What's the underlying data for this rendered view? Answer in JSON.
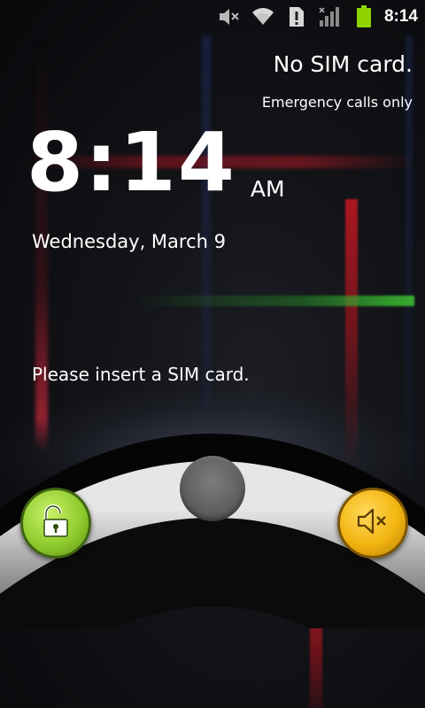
{
  "status_bar": {
    "icons": [
      "mute-icon",
      "wifi-icon",
      "alert-icon",
      "signal-icon",
      "battery-icon"
    ],
    "time": "8:14"
  },
  "lockscreen": {
    "carrier": "No SIM card.",
    "emergency": "Emergency calls only",
    "time": "8:14",
    "ampm": "AM",
    "date": "Wednesday, March 9",
    "message": "Please insert a SIM card."
  },
  "slider": {
    "left_icon": "unlock-icon",
    "right_icon": "sound-off-icon",
    "colors": {
      "unlock": "#8fcc2e",
      "mute": "#f2b410"
    }
  },
  "colors": {
    "text": "#ffffff",
    "battery": "#8fd400"
  }
}
